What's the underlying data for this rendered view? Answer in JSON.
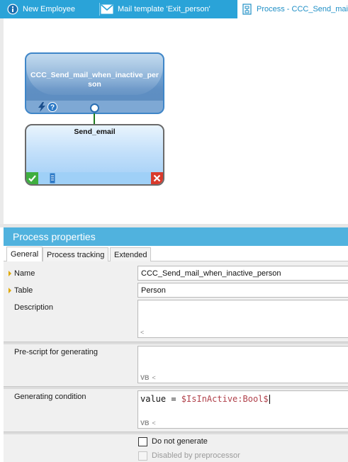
{
  "tabs": [
    {
      "label": "New Employee",
      "icon": "info-icon"
    },
    {
      "label": "Mail template 'Exit_person'",
      "icon": "mail-icon"
    },
    {
      "label": "Process - CCC_Send_mail",
      "icon": "process-document-icon"
    }
  ],
  "canvas": {
    "start_node": {
      "title": "CCC_Send_mail_when_inactive_person"
    },
    "task_node": {
      "title": "Send_email"
    }
  },
  "properties": {
    "header": "Process properties",
    "subtabs": [
      "General",
      "Process tracking",
      "Extended"
    ],
    "fields": {
      "name": {
        "label": "Name",
        "value": "CCC_Send_mail_when_inactive_person"
      },
      "table": {
        "label": "Table",
        "value": "Person"
      },
      "description": {
        "label": "Description",
        "value": ""
      },
      "prescript": {
        "label": "Pre-script for generating",
        "value": "",
        "footer": "VB"
      },
      "condition": {
        "label": "Generating condition",
        "code_prefix": "value = ",
        "code_var": "$IsInActive:Bool$",
        "footer": "VB"
      }
    },
    "checkboxes": [
      {
        "label": "Do not generate",
        "checked": false,
        "disabled": false
      },
      {
        "label": "Disabled by preprocessor",
        "checked": false,
        "disabled": true
      }
    ]
  },
  "colors": {
    "tab_bar": "#2aa3d8",
    "panel_header": "#50b2de",
    "required_marker": "#e0a800"
  }
}
